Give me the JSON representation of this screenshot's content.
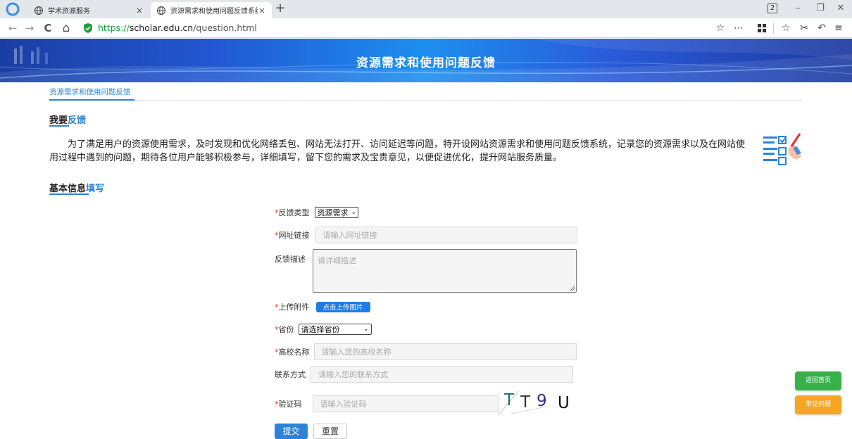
{
  "browser": {
    "tabs": [
      {
        "label": "学术资源服务",
        "active": false
      },
      {
        "label": "资源需求和使用问题反馈系统",
        "active": true
      }
    ],
    "new_tab": "+",
    "tab_count": "2",
    "window_controls": {
      "minimize": "–",
      "restore": "❐",
      "close": "✕"
    },
    "nav": {
      "back": "←",
      "forward": "→",
      "reload": "C",
      "home": "⌂"
    },
    "url": {
      "scheme": "https://",
      "host": "scholar.edu.cn",
      "path": "/question.html"
    },
    "toolbar_icons": [
      "star-icon",
      "more-icon",
      "apps-icon",
      "favorites-icon",
      "cut-icon",
      "undo-icon",
      "menu-icon"
    ],
    "accent": "#1a9e3a"
  },
  "banner": {
    "title": "资源需求和使用问题反馈"
  },
  "breadcrumb": {
    "label": "资源需求和使用问题反馈"
  },
  "feedback_section": {
    "title_main": "我要",
    "title_highlight": "反馈",
    "intro": "为了满足用户的资源使用需求，及时发现和优化网络丢包、网站无法打开、访问延迟等问题，特开设网站资源需求和使用问题反馈系统，记录您的资源需求以及在网站使用过程中遇到的问题，期待各位用户能够积极参与，详细填写，留下您的需求及宝贵意见，以便促进优化，提升网站服务质量。"
  },
  "basic_section": {
    "title_main": "基本信息",
    "title_highlight": "填写"
  },
  "form": {
    "required_mark": "*",
    "type": {
      "label": "反馈类型",
      "value": "资源需求"
    },
    "url": {
      "label": "网址链接",
      "placeholder": "请输入网址链接"
    },
    "desc": {
      "label": "反馈描述",
      "placeholder": "请详细描述"
    },
    "upload": {
      "label": "上传附件",
      "button": "点击上传图片"
    },
    "province": {
      "label": "省份",
      "value": "请选择省份"
    },
    "school": {
      "label": "高校名称",
      "placeholder": "请输入您的高校名称"
    },
    "contact": {
      "label": "联系方式",
      "placeholder": "请输入您的联系方式"
    },
    "captcha": {
      "label": "验证码",
      "placeholder": "请输入验证码",
      "image_text": [
        "T",
        "T",
        "9",
        "U"
      ]
    },
    "submit": "提交",
    "reset": "重置"
  },
  "float": {
    "home": "返回首页",
    "faq": "常见问题"
  },
  "colors": {
    "link": "#2b84d9",
    "required": "#e33333",
    "home_btn": "#37b24a",
    "faq_btn": "#f5a623"
  }
}
